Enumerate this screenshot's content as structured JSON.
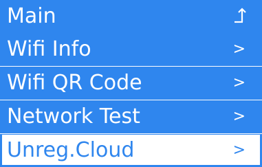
{
  "menu": {
    "items": [
      {
        "label": "Main",
        "arrow": ""
      },
      {
        "label": "Wifi Info",
        "arrow": ">"
      },
      {
        "label": "Wifi QR Code",
        "arrow": ">"
      },
      {
        "label": "Network Test",
        "arrow": ">"
      },
      {
        "label": "Unreg.Cloud",
        "arrow": ">"
      }
    ],
    "selected_index": 4,
    "colors": {
      "accent": "#2f86ee",
      "background": "#ffffff",
      "text_on_accent": "#ffffff"
    }
  }
}
